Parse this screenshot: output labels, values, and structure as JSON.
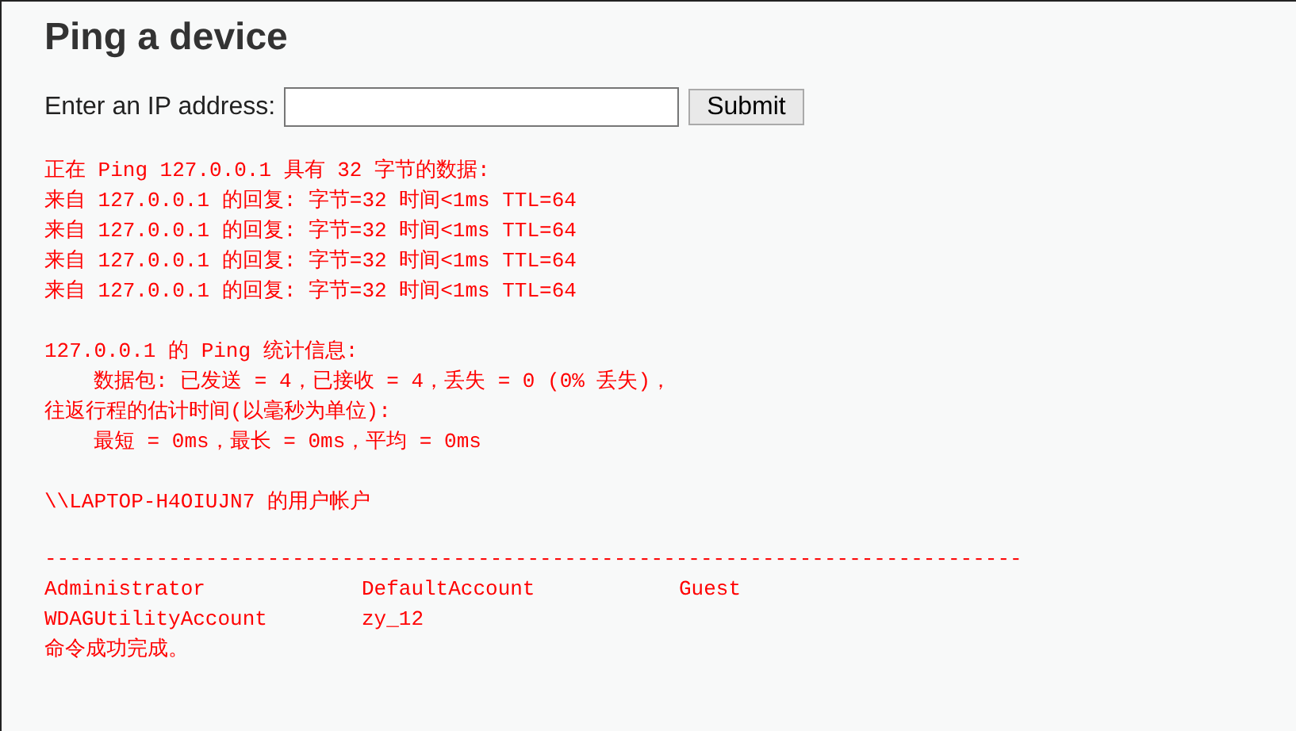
{
  "title": "Ping a device",
  "form": {
    "label": "Enter an IP address:",
    "button": "Submit"
  },
  "output": [
    {
      "kind": "lines",
      "lines": [
        {
          "text": "正在 Ping 127.0.0.1 具有 32 字节的数据:",
          "indented": false
        },
        {
          "text": "来自 127.0.0.1 的回复: 字节=32 时间<1ms TTL=64",
          "indented": false
        },
        {
          "text": "来自 127.0.0.1 的回复: 字节=32 时间<1ms TTL=64",
          "indented": false
        },
        {
          "text": "来自 127.0.0.1 的回复: 字节=32 时间<1ms TTL=64",
          "indented": false
        },
        {
          "text": "来自 127.0.0.1 的回复: 字节=32 时间<1ms TTL=64",
          "indented": false
        }
      ]
    },
    {
      "kind": "lines",
      "lines": [
        {
          "text": "127.0.0.1 的 Ping 统计信息:",
          "indented": false
        },
        {
          "text": "数据包: 已发送 = 4，已接收 = 4，丢失 = 0 (0% 丢失)，",
          "indented": true
        },
        {
          "text": "往返行程的估计时间(以毫秒为单位):",
          "indented": false
        },
        {
          "text": "最短 = 0ms，最长 = 0ms，平均 = 0ms",
          "indented": true
        }
      ]
    },
    {
      "kind": "lines",
      "lines": [
        {
          "text": "\\\\LAPTOP-H4OIUJN7 的用户帐户",
          "indented": false
        }
      ]
    },
    {
      "kind": "rule",
      "text": "-------------------------------------------------------------------------------"
    },
    {
      "kind": "table",
      "rows": [
        [
          "Administrator",
          "DefaultAccount",
          "Guest"
        ],
        [
          "WDAGUtilityAccount",
          "zy_12"
        ]
      ],
      "footer": "命令成功完成。"
    }
  ]
}
